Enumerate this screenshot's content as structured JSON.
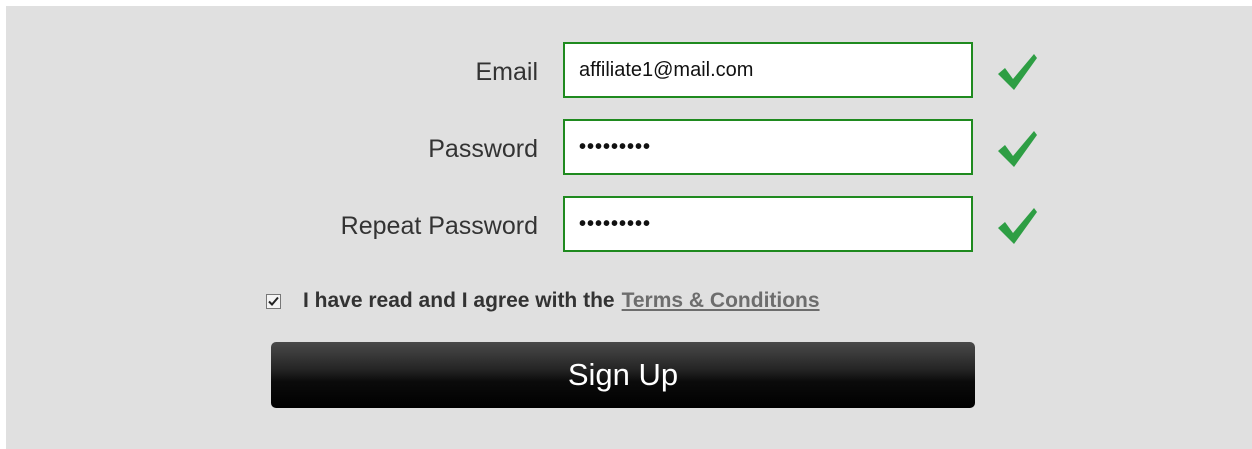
{
  "form": {
    "email": {
      "label": "Email",
      "value": "affiliate1@mail.com"
    },
    "password": {
      "label": "Password",
      "value": "•••••••••"
    },
    "repeat_password": {
      "label": "Repeat Password",
      "value": "•••••••••"
    },
    "agree": {
      "checked": true,
      "text": "I have read and I agree with the",
      "link_text": "Terms & Conditions"
    },
    "signup_label": "Sign Up"
  },
  "colors": {
    "panel_bg": "#e0e0e0",
    "valid_border": "#1f8a1f",
    "check_green": "#2e9e44",
    "button_bg": "#111111"
  }
}
